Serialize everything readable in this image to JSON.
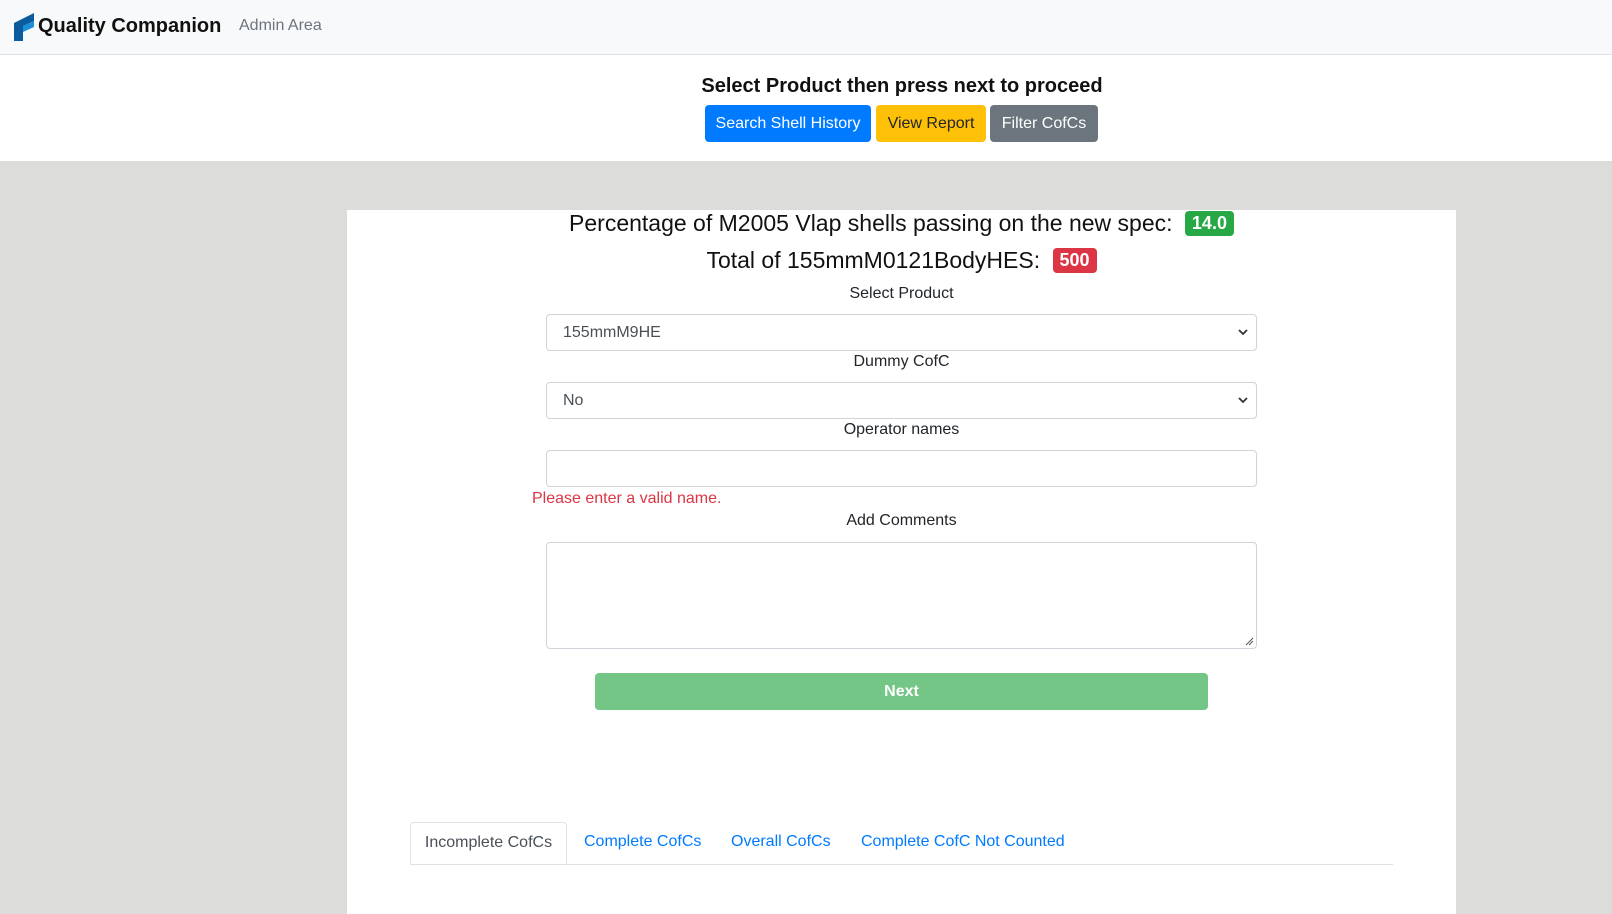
{
  "navbar": {
    "brand": "Quality Companion",
    "admin_link": "Admin Area",
    "logo_icon": "quality-companion-logo-icon"
  },
  "top": {
    "instruction": "Select Product then press next to proceed",
    "buttons": {
      "search": "Search Shell History",
      "report": "View Report",
      "filter": "Filter CofCs"
    }
  },
  "stats": {
    "percentage_label": "Percentage of M2005 Vlap shells passing on the new spec:",
    "percentage_value": "14.0",
    "total_label": "Total of 155mmM0121BodyHES:",
    "total_value": "500"
  },
  "form": {
    "product_label": "Select Product",
    "product_value": "155mmM9HE",
    "dummy_label": "Dummy CofC",
    "dummy_value": "No",
    "operator_label": "Operator names",
    "operator_value": "",
    "operator_error": "Please enter a valid name.",
    "comments_label": "Add Comments",
    "comments_value": "",
    "next_label": "Next"
  },
  "tabs": [
    "Incomplete CofCs",
    "Complete CofCs",
    "Overall CofCs",
    "Complete CofC Not Counted"
  ],
  "colors": {
    "primary": "#007bff",
    "warning": "#ffc107",
    "secondary": "#6c757d",
    "success": "#28a745",
    "danger": "#dc3545",
    "next_button": "#74c687"
  }
}
